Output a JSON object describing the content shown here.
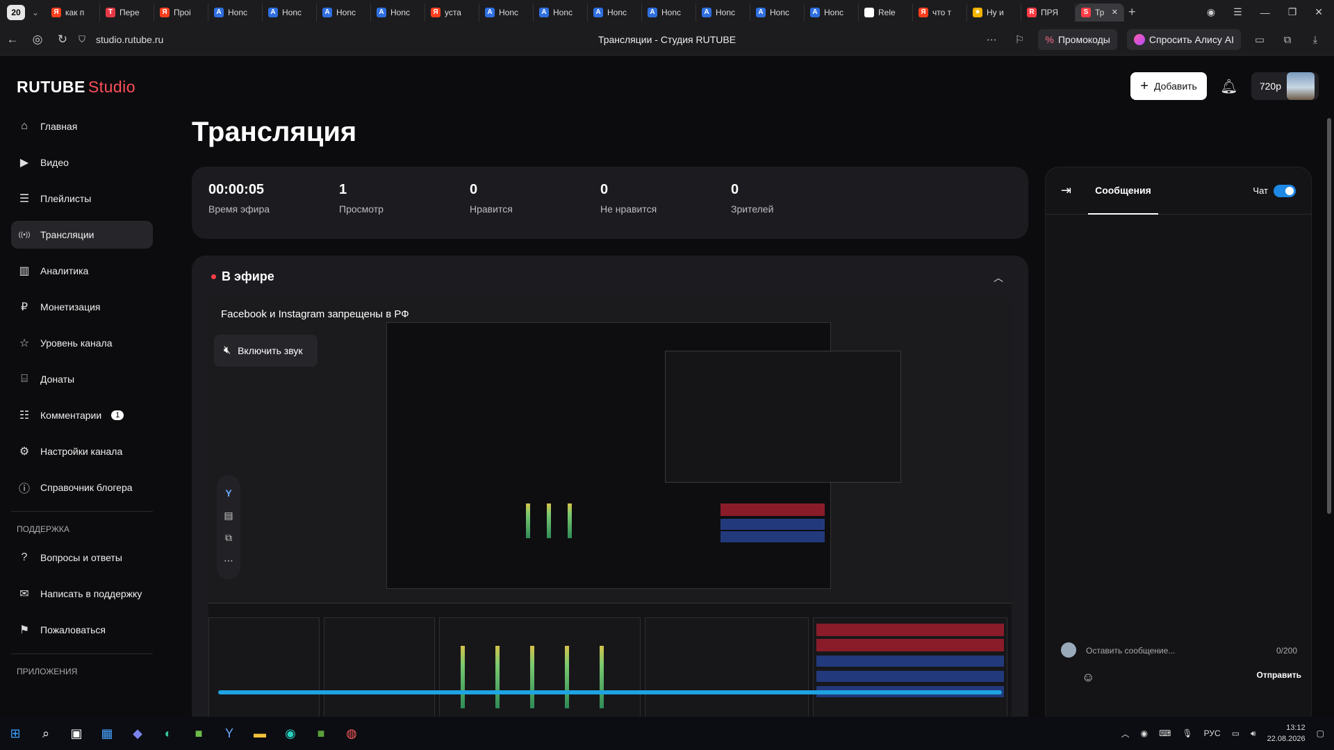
{
  "browser": {
    "tab_count": "20",
    "tabs": [
      {
        "label": "как п",
        "icon": "Я",
        "color": "#fc3f1d"
      },
      {
        "label": "Пере",
        "icon": "T",
        "color": "#e63946"
      },
      {
        "label": "Проі",
        "icon": "Я",
        "color": "#fc3f1d"
      },
      {
        "label": "Honc",
        "icon": "A",
        "color": "#2f6fe0"
      },
      {
        "label": "Honc",
        "icon": "A",
        "color": "#2f6fe0"
      },
      {
        "label": "Honc",
        "icon": "A",
        "color": "#2f6fe0"
      },
      {
        "label": "Honc",
        "icon": "A",
        "color": "#2f6fe0"
      },
      {
        "label": "уста",
        "icon": "Я",
        "color": "#fc3f1d"
      },
      {
        "label": "Honc",
        "icon": "A",
        "color": "#2f6fe0"
      },
      {
        "label": "Honc",
        "icon": "A",
        "color": "#2f6fe0"
      },
      {
        "label": "Honc",
        "icon": "A",
        "color": "#2f6fe0"
      },
      {
        "label": "Honc",
        "icon": "A",
        "color": "#2f6fe0"
      },
      {
        "label": "Honc",
        "icon": "A",
        "color": "#2f6fe0"
      },
      {
        "label": "Honc",
        "icon": "A",
        "color": "#2f6fe0"
      },
      {
        "label": "Honc",
        "icon": "A",
        "color": "#2f6fe0"
      },
      {
        "label": "Rele",
        "icon": "●",
        "color": "#ffffff"
      },
      {
        "label": "что т",
        "icon": "Я",
        "color": "#fc3f1d"
      },
      {
        "label": "Ну и",
        "icon": "★",
        "color": "#f0b400"
      },
      {
        "label": "ПРЯ",
        "icon": "R",
        "color": "#ff3c45"
      },
      {
        "label": "Тр",
        "icon": "S",
        "color": "#ff3c45",
        "active": true
      }
    ],
    "url": "studio.rutube.ru",
    "page_title": "Трансляции - Студия RUTUBE",
    "promo_label": "Промокоды",
    "alice_label": "Спросить Алису AI"
  },
  "app": {
    "logo_main": "RUTUBE",
    "logo_sub": "Studio",
    "add_button": "Добавить",
    "quality": "720p"
  },
  "sidebar": {
    "items": [
      {
        "label": "Главная",
        "icon": "home-icon",
        "glyph": "⌂"
      },
      {
        "label": "Видео",
        "icon": "video-icon",
        "glyph": "▶"
      },
      {
        "label": "Плейлисты",
        "icon": "playlist-icon",
        "glyph": "☰"
      },
      {
        "label": "Трансляции",
        "icon": "broadcast-icon",
        "glyph": "((•))",
        "active": true
      },
      {
        "label": "Аналитика",
        "icon": "analytics-icon",
        "glyph": "▥"
      },
      {
        "label": "Монетизация",
        "icon": "monetization-icon",
        "glyph": "₽"
      },
      {
        "label": "Уровень канала",
        "icon": "star-icon",
        "glyph": "☆"
      },
      {
        "label": "Донаты",
        "icon": "donate-icon",
        "glyph": "⌸"
      },
      {
        "label": "Комментарии",
        "icon": "comments-icon",
        "glyph": "☷",
        "badge": "1"
      },
      {
        "label": "Настройки канала",
        "icon": "gear-icon",
        "glyph": "⚙"
      },
      {
        "label": "Справочник блогера",
        "icon": "info-icon",
        "glyph": "ⓘ"
      }
    ],
    "support_title": "ПОДДЕРЖКА",
    "support_items": [
      {
        "label": "Вопросы и ответы",
        "icon": "help-icon",
        "glyph": "?"
      },
      {
        "label": "Написать в поддержку",
        "icon": "mail-icon",
        "glyph": "✉"
      },
      {
        "label": "Пожаловаться",
        "icon": "flag-icon",
        "glyph": "⚑"
      }
    ],
    "apps_title": "ПРИЛОЖЕНИЯ"
  },
  "main": {
    "title": "Трансляция",
    "stats": [
      {
        "value": "00:00:05",
        "label": "Время эфира"
      },
      {
        "value": "1",
        "label": "Просмотр"
      },
      {
        "value": "0",
        "label": "Нравится"
      },
      {
        "value": "0",
        "label": "Не нравится"
      },
      {
        "value": "0",
        "label": "Зрителей"
      }
    ],
    "live_title": "В эфире",
    "warning": "Facebook и Instagram запрещены в РФ",
    "unmute_label": "Включить звук",
    "progress": 1.0
  },
  "chat": {
    "tab": "Сообщения",
    "toggle_label": "Чат",
    "placeholder": "Оставить сообщение...",
    "counter": "0/200",
    "send": "Отправить"
  },
  "system": {
    "lang": "РУС",
    "time": "13:12",
    "date": "22.08.2026"
  }
}
